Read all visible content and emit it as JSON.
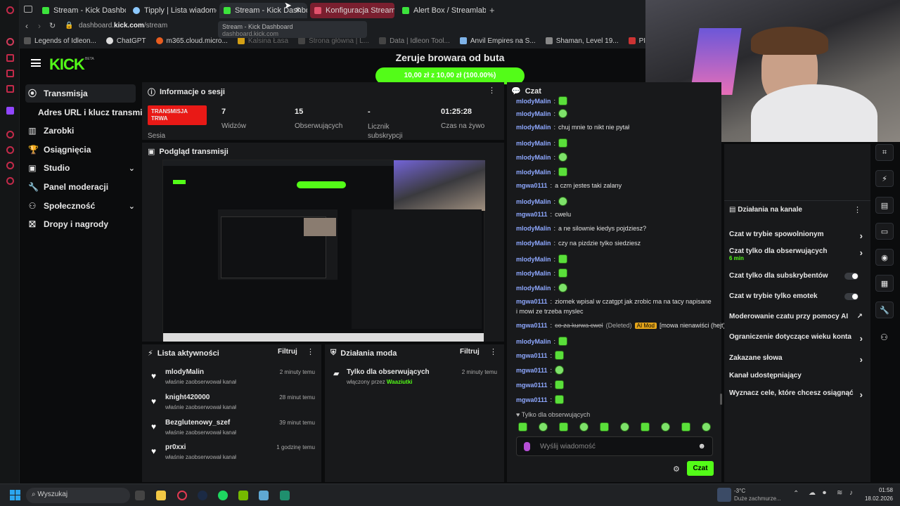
{
  "browser": {
    "tabs": [
      {
        "label": "Stream - Kick Dashboard"
      },
      {
        "label": "Tipply | Lista wiadomości"
      },
      {
        "label": "Stream - Kick Dashboard",
        "active": true
      },
      {
        "label": "Konfiguracja Streamlabs"
      },
      {
        "label": "Alert Box / Streamlabs"
      }
    ],
    "url": "dashboard.kick.com/stream",
    "url_domain": "dashboard.",
    "url_bold": "kick.com",
    "url_path": "/stream",
    "tooltip_title": "Stream - Kick Dashboard",
    "tooltip_url": "dashboard.kick.com",
    "bookmarks": [
      {
        "label": "Legends of Idleon..."
      },
      {
        "label": "ChatGPT"
      },
      {
        "label": "m365.cloud.micro..."
      },
      {
        "label": "Kalsina Łasa"
      },
      {
        "label": "Strona główna | L..."
      },
      {
        "label": "Data | Idleon Tool..."
      },
      {
        "label": "Anvil Empires na S..."
      },
      {
        "label": "Shaman, Level 19..."
      },
      {
        "label": "PIÓREX Poduszka..."
      }
    ]
  },
  "header": {
    "logo": "KICK",
    "logo_badge": "BETA",
    "goal_title": "Zeruje browara od buta",
    "goal_progress": "10,00 zł z 10,00 zł (100.00%)",
    "goal_fraction": 1.0
  },
  "sidebar": {
    "items": [
      {
        "label": "Transmisja",
        "icon": "broadcast-icon"
      },
      {
        "label": "Adres URL i klucz transmisji"
      },
      {
        "label": "Zarobki",
        "icon": "chart-icon"
      },
      {
        "label": "Osiągnięcia",
        "icon": "trophy-icon"
      },
      {
        "label": "Studio",
        "icon": "studio-icon"
      },
      {
        "label": "Panel moderacji",
        "icon": "wrench-icon"
      },
      {
        "label": "Społeczność",
        "icon": "community-icon"
      },
      {
        "label": "Dropy i nagrody",
        "icon": "gift-icon"
      }
    ]
  },
  "session": {
    "title": "Informacje o sesji",
    "live_badge": "TRANSMISJA TRWA",
    "sesja": "Sesia",
    "stats": [
      {
        "value": "7",
        "label": "Widzów"
      },
      {
        "value": "15",
        "label": "Obserwujących"
      },
      {
        "value": "-",
        "label": "Licznik subskrypcji"
      },
      {
        "value": "01:25:28",
        "label": "Czas na żywo"
      }
    ]
  },
  "preview": {
    "title": "Podgląd transmisji"
  },
  "activity": {
    "title": "Lista aktywności",
    "filter": "Filtruj",
    "items": [
      {
        "name": "mlodyMalin",
        "sub": "właśnie zaobserwował kanał",
        "time": "2 minuty temu"
      },
      {
        "name": "knight420000",
        "sub": "właśnie zaobserwował kanał",
        "time": "28 minut temu"
      },
      {
        "name": "Bezglutenowy_szef",
        "sub": "właśnie zaobserwował kanał",
        "time": "39 minut temu"
      },
      {
        "name": "pr0xxi",
        "sub": "właśnie zaobserwował kanał",
        "time": "1 godzinę temu"
      }
    ]
  },
  "modactions": {
    "title": "Działania moda",
    "filter": "Filtruj",
    "item_title": "Tylko dla obserwujących",
    "item_sub": "włączony przez ",
    "item_user": "Waaziutki",
    "item_time": "2 minuty temu"
  },
  "chat": {
    "title": "Czat",
    "messages": [
      {
        "user": "mlodyMalin",
        "text": "",
        "emote": true
      },
      {
        "user": "mlodyMalin",
        "text": "",
        "emote": true
      },
      {
        "user": "mlodyMalin",
        "text": "chuj mnie to nikt nie pytał",
        "emote": false
      },
      {
        "user": "mlodyMalin",
        "text": "",
        "emote": true
      },
      {
        "user": "mlodyMalin",
        "text": "",
        "emote": true
      },
      {
        "user": "mlodyMalin",
        "text": "",
        "emote": true
      },
      {
        "user": "mgwa0111",
        "text": "a czm jestes taki zalany",
        "emote": false
      },
      {
        "user": "mlodyMalin",
        "text": "",
        "emote": true
      },
      {
        "user": "mgwa0111",
        "text": "cwelu",
        "emote": false
      },
      {
        "user": "mlodyMalin",
        "text": "a ne silownie kiedys pojdziesz?",
        "emote": false
      },
      {
        "user": "mlodyMalin",
        "text": "czy na pizdzie tylko siedziesz",
        "emote": false
      },
      {
        "user": "mlodyMalin",
        "text": "",
        "emote": true
      },
      {
        "user": "mlodyMalin",
        "text": "",
        "emote": true
      },
      {
        "user": "mlodyMalin",
        "text": "",
        "emote": true
      },
      {
        "user": "mgwa0111",
        "text": "ziomek wpisal w czatgpt jak zrobic ma na tacy napisane",
        "emote": false
      },
      {
        "user": "",
        "text": "i mowi ze trzeba myslec",
        "emote": false
      },
      {
        "user": "mgwa0111",
        "text": "co za kurwa cwel",
        "emote": false,
        "deleted": "(Deleted)",
        "badge": "AI Mod",
        "reason": "[mowa nienawiści (hejt)]"
      },
      {
        "user": "mlodyMalin",
        "text": "",
        "emote": true
      },
      {
        "user": "mgwa0111",
        "text": "",
        "emote": true
      },
      {
        "user": "mgwa0111",
        "text": "",
        "emote": true
      },
      {
        "user": "mgwa0111",
        "text": "",
        "emote": true
      },
      {
        "user": "mgwa0111",
        "text": "",
        "emote": true
      }
    ],
    "followers_only": "Tylko dla obserwujących",
    "input_placeholder": "Wyślij wiadomość",
    "send_button": "Czat"
  },
  "channel_actions": {
    "title": "Działania na kanale",
    "items": [
      {
        "label": "Czat w trybie spowolnionym",
        "control": "chevron"
      },
      {
        "label": "Czat tylko dla obserwujących",
        "extra": "6 min",
        "control": "chevron"
      },
      {
        "label": "Czat tylko dla subskrybentów",
        "control": "toggle"
      },
      {
        "label": "Czat w trybie tylko emotek",
        "control": "toggle"
      },
      {
        "label": "Moderowanie czatu przy pomocy AI",
        "control": "link"
      },
      {
        "label": "Ograniczenie dotyczące wieku konta",
        "control": "chevron"
      },
      {
        "label": "Zakazane słowa",
        "control": "chevron"
      },
      {
        "label": "Kanał udostępniający",
        "control": "none"
      },
      {
        "label": "Wyznacz cele, które chcesz osiągnąć",
        "control": "chevron"
      }
    ]
  },
  "taskbar": {
    "search": "Wyszukaj",
    "weather_temp": "-3°C",
    "weather_desc": "Duże zachmurze...",
    "time": "01:58",
    "date": "18.02.2026"
  },
  "colors": {
    "kick_green": "#53fc18",
    "live_red": "#e91916",
    "bg": "#0b0c0d",
    "panel": "#18191b"
  }
}
